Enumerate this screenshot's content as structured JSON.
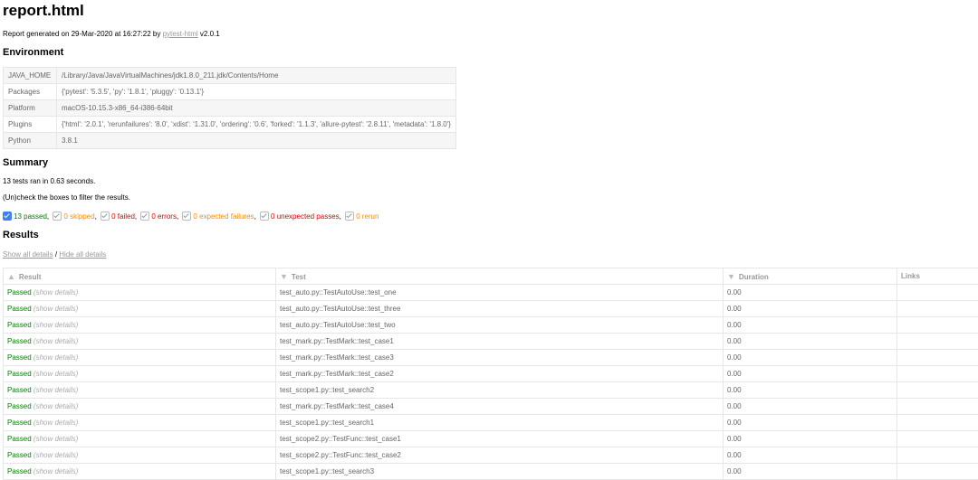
{
  "title": "report.html",
  "generated": {
    "prefix": "Report generated on 29-Mar-2020 at 16:27:22 by ",
    "link": "pytest-html",
    "version": " v2.0.1"
  },
  "environment": {
    "heading": "Environment",
    "rows": [
      {
        "key": "JAVA_HOME",
        "value": "/Library/Java/JavaVirtualMachines/jdk1.8.0_211.jdk/Contents/Home"
      },
      {
        "key": "Packages",
        "value": "{'pytest': '5.3.5', 'py': '1.8.1', 'pluggy': '0.13.1'}"
      },
      {
        "key": "Platform",
        "value": "macOS-10.15.3-x86_64-i386-64bit"
      },
      {
        "key": "Plugins",
        "value": "{'html': '2.0.1', 'rerunfailures': '8.0', 'xdist': '1.31.0', 'ordering': '0.6', 'forked': '1.1.3', 'allure-pytest': '2.8.11', 'metadata': '1.8.0'}"
      },
      {
        "key": "Python",
        "value": "3.8.1"
      }
    ]
  },
  "summary": {
    "heading": "Summary",
    "ran": "13 tests ran in 0.63 seconds.",
    "filter_hint": "(Un)check the boxes to filter the results.",
    "filters": [
      {
        "label": "13 passed",
        "sep": ",",
        "cls": "passed",
        "checked": true
      },
      {
        "label": "0 skipped",
        "sep": ",",
        "cls": "skipped",
        "checked": false
      },
      {
        "label": "0 failed",
        "sep": ",",
        "cls": "failed",
        "checked": false
      },
      {
        "label": "0 errors",
        "sep": ",",
        "cls": "errors",
        "checked": false
      },
      {
        "label": "0 expected failures",
        "sep": ",",
        "cls": "xfailed",
        "checked": false
      },
      {
        "label": "0 unexpected passes",
        "sep": ",",
        "cls": "xpassed",
        "checked": false
      },
      {
        "label": "0 rerun",
        "sep": "",
        "cls": "rerun",
        "checked": false
      }
    ]
  },
  "results": {
    "heading": "Results",
    "show_all": "Show all details",
    "separator": " / ",
    "hide_all": "Hide all details",
    "columns": [
      "Result",
      "Test",
      "Duration",
      "Links"
    ],
    "show_details": "(show details)",
    "rows": [
      {
        "result": "Passed",
        "test": "test_auto.py::TestAutoUse::test_one",
        "duration": "0.00"
      },
      {
        "result": "Passed",
        "test": "test_auto.py::TestAutoUse::test_three",
        "duration": "0.00"
      },
      {
        "result": "Passed",
        "test": "test_auto.py::TestAutoUse::test_two",
        "duration": "0.00"
      },
      {
        "result": "Passed",
        "test": "test_mark.py::TestMark::test_case1",
        "duration": "0.00"
      },
      {
        "result": "Passed",
        "test": "test_mark.py::TestMark::test_case3",
        "duration": "0.00"
      },
      {
        "result": "Passed",
        "test": "test_mark.py::TestMark::test_case2",
        "duration": "0.00"
      },
      {
        "result": "Passed",
        "test": "test_scope1.py::test_search2",
        "duration": "0.00"
      },
      {
        "result": "Passed",
        "test": "test_mark.py::TestMark::test_case4",
        "duration": "0.00"
      },
      {
        "result": "Passed",
        "test": "test_scope1.py::test_search1",
        "duration": "0.00"
      },
      {
        "result": "Passed",
        "test": "test_scope2.py::TestFunc::test_case1",
        "duration": "0.00"
      },
      {
        "result": "Passed",
        "test": "test_scope2.py::TestFunc::test_case2",
        "duration": "0.00"
      },
      {
        "result": "Passed",
        "test": "test_scope1.py::test_search3",
        "duration": "0.00"
      }
    ]
  },
  "colors": {
    "passed": "#008000",
    "failed": "#e00000",
    "skipped": "#ff8c00",
    "link": "#999999"
  }
}
